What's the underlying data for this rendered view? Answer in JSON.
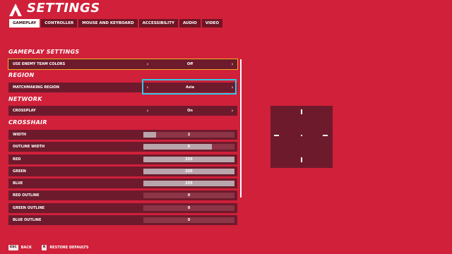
{
  "header": {
    "title": "SETTINGS",
    "logo": "chevron-logo-icon"
  },
  "tabs": [
    {
      "label": "GAMEPLAY",
      "active": true
    },
    {
      "label": "CONTROLLER",
      "active": false
    },
    {
      "label": "MOUSE AND KEYBOARD",
      "active": false
    },
    {
      "label": "ACCESSIBILITY",
      "active": false
    },
    {
      "label": "AUDIO",
      "active": false
    },
    {
      "label": "VIDEO",
      "active": false
    }
  ],
  "sections": {
    "gameplay": "GAMEPLAY SETTINGS",
    "region": "REGION",
    "network": "NETWORK",
    "crosshair": "CROSSHAIR"
  },
  "gameplay_rows": [
    {
      "label": "USE ENEMY TEAM COLORS",
      "value": "Off"
    }
  ],
  "region_rows": [
    {
      "label": "MATCHMAKING REGION",
      "value": "Asia"
    }
  ],
  "network_rows": [
    {
      "label": "CROSSPLAY",
      "value": "On"
    }
  ],
  "crosshair_rows": [
    {
      "label": "WIDTH",
      "value": "2",
      "fill": 0.14
    },
    {
      "label": "OUTLINE WIDTH",
      "value": "6",
      "fill": 0.75
    },
    {
      "label": "RED",
      "value": "255",
      "fill": 1.0
    },
    {
      "label": "GREEN",
      "value": "255",
      "fill": 1.0
    },
    {
      "label": "BLUE",
      "value": "255",
      "fill": 1.0
    },
    {
      "label": "RED OUTLINE",
      "value": "0",
      "fill": 0.0
    },
    {
      "label": "GREEN OUTLINE",
      "value": "0",
      "fill": 0.0
    },
    {
      "label": "BLUE OUTLINE",
      "value": "0",
      "fill": 0.0
    }
  ],
  "footer": {
    "back_key": "ESC",
    "back_label": "BACK",
    "restore_key": "R",
    "restore_label": "RESTORE DEFAULTS"
  },
  "colors": {
    "background": "#d0203a",
    "row": "#6d1a2c",
    "focus": "#36c6e6",
    "hover": "#f2b026"
  }
}
